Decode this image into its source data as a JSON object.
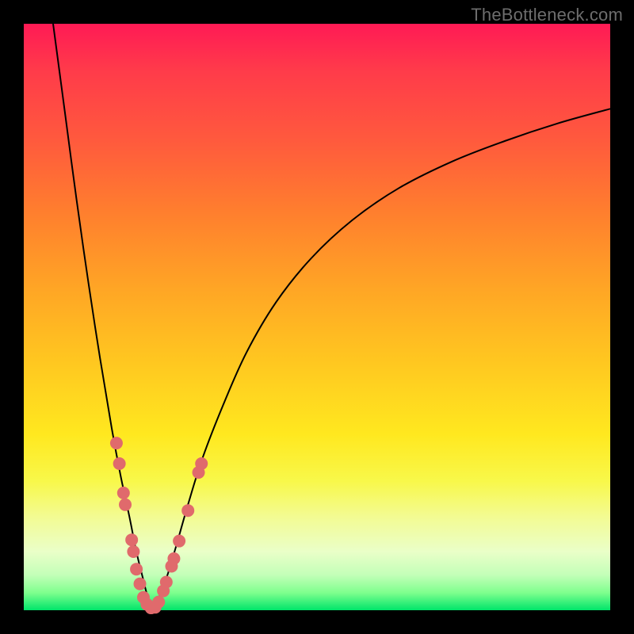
{
  "watermark": "TheBottleneck.com",
  "colors": {
    "dot": "#e06a6c",
    "curve": "#000000",
    "frame_bg_top": "#ff1a55",
    "frame_bg_bottom": "#00e56a",
    "page_bg": "#000000"
  },
  "chart_data": {
    "type": "line",
    "title": "",
    "xlabel": "",
    "ylabel": "",
    "xlim": [
      0,
      100
    ],
    "ylim": [
      0,
      100
    ],
    "series": [
      {
        "name": "left-branch",
        "x": [
          5,
          7,
          9,
          11,
          13,
          15,
          16.5,
          18,
          19.2,
          20.3,
          21.2,
          22
        ],
        "y": [
          100,
          85,
          70,
          56,
          43,
          31,
          23,
          16,
          10,
          5.5,
          2,
          0
        ]
      },
      {
        "name": "right-branch",
        "x": [
          22,
          23,
          24.5,
          26,
          28,
          30.5,
          34,
          38,
          43,
          49,
          56,
          64,
          73,
          82,
          91,
          100
        ],
        "y": [
          0,
          2,
          6,
          11,
          18,
          26,
          35,
          44,
          52.5,
          60,
          66.5,
          72,
          76.5,
          80,
          83,
          85.5
        ]
      }
    ],
    "scatter": {
      "name": "highlighted-points",
      "points": [
        {
          "x": 15.8,
          "y": 28.5
        },
        {
          "x": 16.3,
          "y": 25.0
        },
        {
          "x": 17.0,
          "y": 20.0
        },
        {
          "x": 17.3,
          "y": 18.0
        },
        {
          "x": 18.4,
          "y": 12.0
        },
        {
          "x": 18.7,
          "y": 10.0
        },
        {
          "x": 19.2,
          "y": 7.0
        },
        {
          "x": 19.8,
          "y": 4.5
        },
        {
          "x": 20.4,
          "y": 2.2
        },
        {
          "x": 21.0,
          "y": 1.0
        },
        {
          "x": 21.7,
          "y": 0.4
        },
        {
          "x": 22.4,
          "y": 0.5
        },
        {
          "x": 23.0,
          "y": 1.4
        },
        {
          "x": 23.8,
          "y": 3.3
        },
        {
          "x": 24.3,
          "y": 4.8
        },
        {
          "x": 25.2,
          "y": 7.5
        },
        {
          "x": 25.6,
          "y": 8.8
        },
        {
          "x": 26.5,
          "y": 11.8
        },
        {
          "x": 28.0,
          "y": 17.0
        },
        {
          "x": 29.8,
          "y": 23.5
        },
        {
          "x": 30.3,
          "y": 25.0
        }
      ]
    }
  }
}
